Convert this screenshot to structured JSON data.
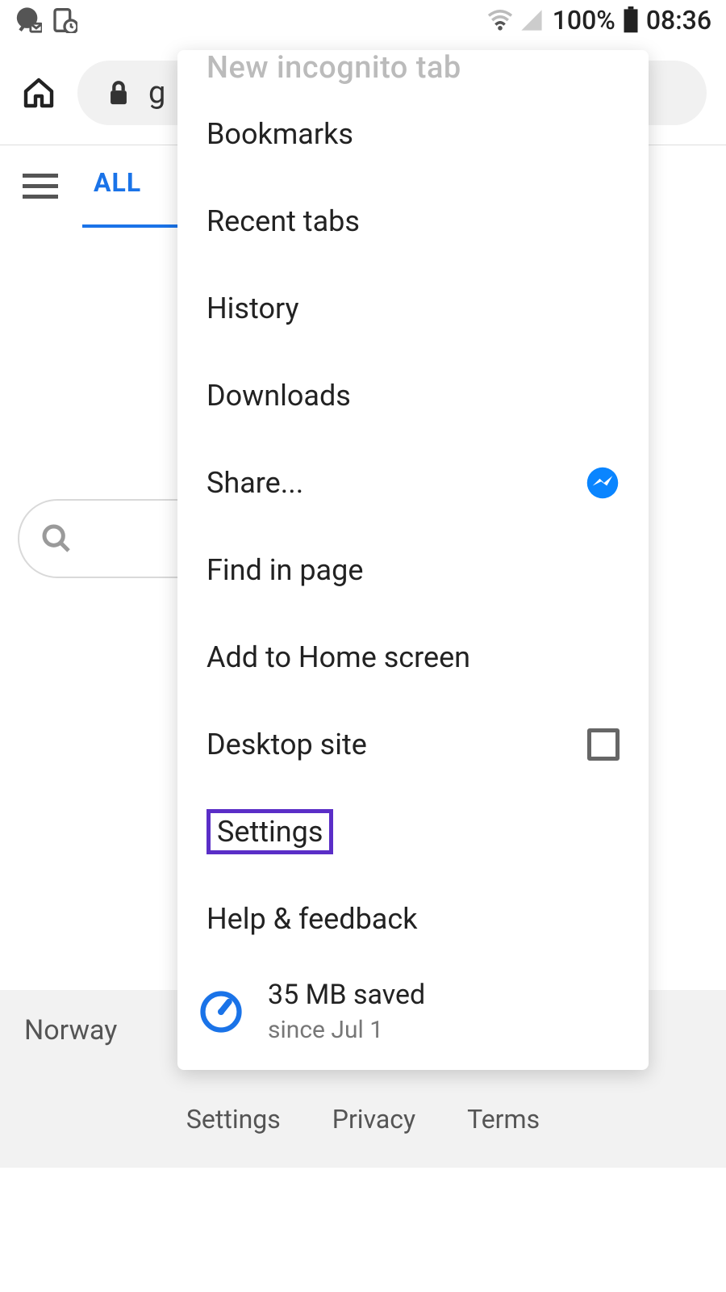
{
  "status": {
    "battery_pct": "100%",
    "time": "08:36"
  },
  "toolbar": {
    "url_fragment": "g"
  },
  "tabs": {
    "all_label": "ALL"
  },
  "menu": {
    "cutoff_label": "New incognito tab",
    "bookmarks": "Bookmarks",
    "recent_tabs": "Recent tabs",
    "history": "History",
    "downloads": "Downloads",
    "share": "Share...",
    "find_in_page": "Find in page",
    "add_to_home": "Add to Home screen",
    "desktop_site": "Desktop site",
    "settings": "Settings",
    "help_feedback": "Help & feedback",
    "data_saver": {
      "title": "35 MB saved",
      "subtitle": "since Jul 1"
    }
  },
  "footer": {
    "region": "Norway",
    "settings": "Settings",
    "privacy": "Privacy",
    "terms": "Terms"
  }
}
